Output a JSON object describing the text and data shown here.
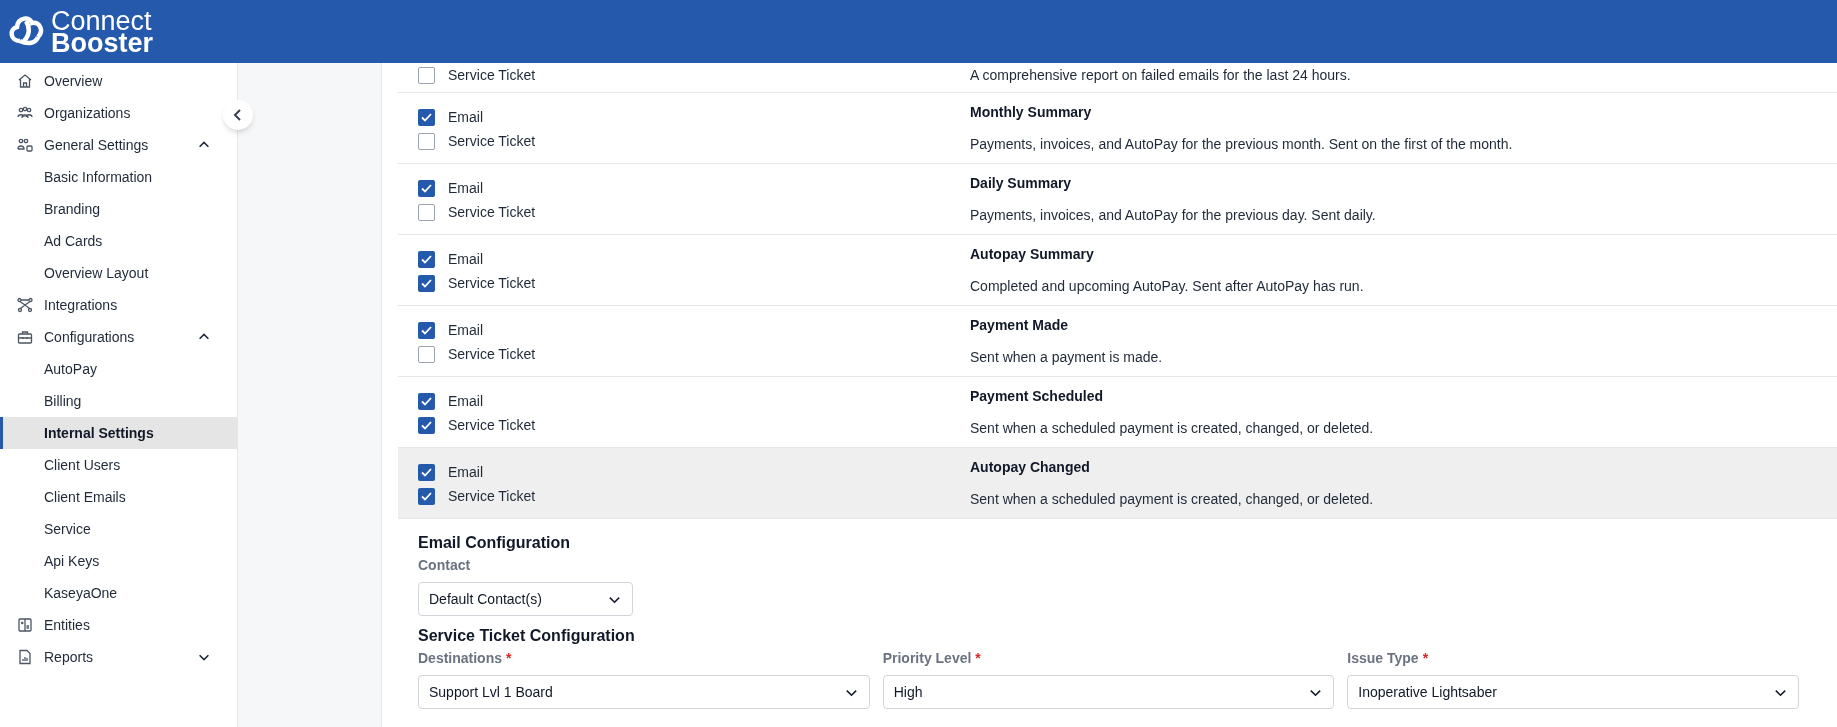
{
  "header": {
    "logo_line_1": "Connect",
    "logo_line_2": "Booster"
  },
  "sidebar": {
    "items": [
      {
        "label": "Overview",
        "selected": false
      },
      {
        "label": "Organizations",
        "selected": false
      },
      {
        "label": "General Settings",
        "selected": false,
        "expanded": true,
        "children": [
          {
            "label": "Basic Information",
            "selected": false
          },
          {
            "label": "Branding",
            "selected": false
          },
          {
            "label": "Ad Cards",
            "selected": false
          },
          {
            "label": "Overview Layout",
            "selected": false
          }
        ]
      },
      {
        "label": "Integrations",
        "selected": false
      },
      {
        "label": "Configurations",
        "selected": false,
        "expanded": true,
        "children": [
          {
            "label": "AutoPay",
            "selected": false
          },
          {
            "label": "Billing",
            "selected": false
          },
          {
            "label": "Internal Settings",
            "selected": true
          },
          {
            "label": "Client Users",
            "selected": false
          },
          {
            "label": "Client Emails",
            "selected": false
          },
          {
            "label": "Service",
            "selected": false
          },
          {
            "label": "Api Keys",
            "selected": false
          },
          {
            "label": "KaseyaOne",
            "selected": false
          }
        ]
      },
      {
        "label": "Entities",
        "selected": false
      },
      {
        "label": "Reports",
        "selected": false,
        "expanded": false
      }
    ]
  },
  "notifications": [
    {
      "kind": "partial",
      "highlighted": false,
      "options": [
        {
          "label": "Service Ticket",
          "checked": false
        }
      ],
      "description": "A comprehensive report on failed emails for the last 24 hours."
    },
    {
      "kind": "full",
      "highlighted": false,
      "options": [
        {
          "label": "Email",
          "checked": true
        },
        {
          "label": "Service Ticket",
          "checked": false
        }
      ],
      "title": "Monthly Summary",
      "description": "Payments, invoices, and AutoPay for the previous month. Sent on the first of the month."
    },
    {
      "kind": "full",
      "highlighted": false,
      "options": [
        {
          "label": "Email",
          "checked": true
        },
        {
          "label": "Service Ticket",
          "checked": false
        }
      ],
      "title": "Daily Summary",
      "description": "Payments, invoices, and AutoPay for the previous day. Sent daily."
    },
    {
      "kind": "full",
      "highlighted": false,
      "options": [
        {
          "label": "Email",
          "checked": true
        },
        {
          "label": "Service Ticket",
          "checked": true
        }
      ],
      "title": "Autopay Summary",
      "description": "Completed and upcoming AutoPay. Sent after AutoPay has run."
    },
    {
      "kind": "full",
      "highlighted": false,
      "options": [
        {
          "label": "Email",
          "checked": true
        },
        {
          "label": "Service Ticket",
          "checked": false
        }
      ],
      "title": "Payment Made",
      "description": "Sent when a payment is made."
    },
    {
      "kind": "full",
      "highlighted": false,
      "options": [
        {
          "label": "Email",
          "checked": true
        },
        {
          "label": "Service Ticket",
          "checked": true
        }
      ],
      "title": "Payment Scheduled",
      "description": "Sent when a scheduled payment is created, changed, or deleted."
    },
    {
      "kind": "full",
      "highlighted": true,
      "options": [
        {
          "label": "Email",
          "checked": true
        },
        {
          "label": "Service Ticket",
          "checked": true
        }
      ],
      "title": "Autopay Changed",
      "description": "Sent when a scheduled payment is created, changed, or deleted."
    }
  ],
  "email_configuration": {
    "heading": "Email Configuration",
    "contact": {
      "label": "Contact",
      "value": "Default Contact(s)"
    }
  },
  "service_ticket_configuration": {
    "heading": "Service Ticket Configuration",
    "fields": [
      {
        "label": "Destinations",
        "required_mark": "*",
        "value": "Support Lvl 1 Board"
      },
      {
        "label": "Priority Level",
        "required_mark": "*",
        "value": "High"
      },
      {
        "label": "Issue Type",
        "required_mark": "*",
        "value": "Inoperative Lightsaber"
      }
    ]
  }
}
